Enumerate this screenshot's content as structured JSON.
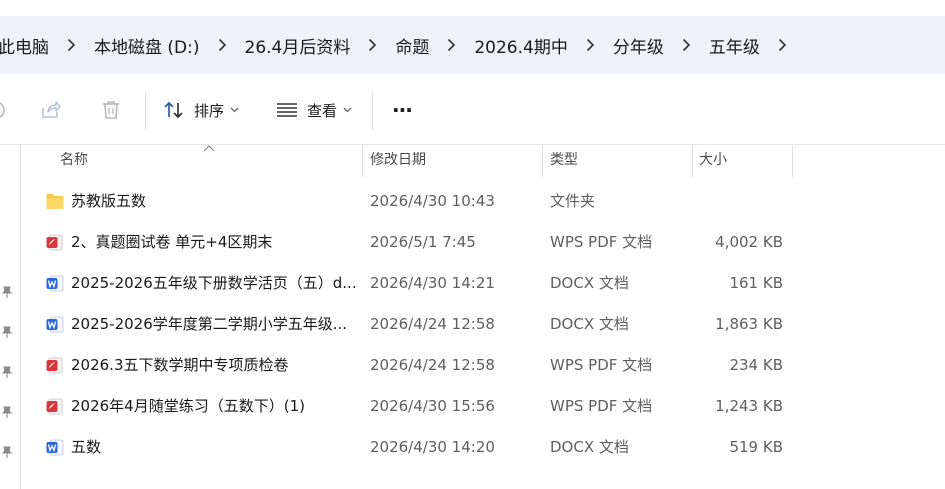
{
  "breadcrumb": {
    "items": [
      "此电脑",
      "本地磁盘 (D:)",
      "26.4月后资料",
      "命题",
      "2026.4期中",
      "分年级",
      "五年级"
    ]
  },
  "toolbar": {
    "sort_label": "排序",
    "view_label": "查看",
    "more_label": "···"
  },
  "columns": {
    "name": "名称",
    "date": "修改日期",
    "type": "类型",
    "size": "大小"
  },
  "files": [
    {
      "name": "苏教版五数",
      "date": "2026/4/30 10:43",
      "type": "文件夹",
      "size": "",
      "icon": "folder-icon"
    },
    {
      "name": "2、真题圈试卷  单元+4区期末",
      "date": "2026/5/1 7:45",
      "type": "WPS PDF 文档",
      "size": "4,002 KB",
      "icon": "pdf-file-icon"
    },
    {
      "name": "2025-2026五年级下册数学活页（五）d...",
      "date": "2026/4/30 14:21",
      "type": "DOCX 文档",
      "size": "161 KB",
      "icon": "word-file-icon"
    },
    {
      "name": "2025-2026学年度第二学期小学五年级...",
      "date": "2026/4/24 12:58",
      "type": "DOCX 文档",
      "size": "1,863 KB",
      "icon": "word-file-icon"
    },
    {
      "name": "2026.3五下数学期中专项质检卷",
      "date": "2026/4/24 12:58",
      "type": "WPS PDF 文档",
      "size": "234 KB",
      "icon": "pdf-file-icon"
    },
    {
      "name": "2026年4月随堂练习（五数下）(1)",
      "date": "2026/4/30 15:56",
      "type": "WPS PDF 文档",
      "size": "1,243 KB",
      "icon": "pdf-file-icon"
    },
    {
      "name": "五数",
      "date": "2026/4/30 14:20",
      "type": "DOCX 文档",
      "size": "519 KB",
      "icon": "word-file-icon"
    }
  ],
  "colors": {
    "breadcrumb_bg": "#eef3f9",
    "folder": "#f8c84a",
    "pdf": "#d9363e",
    "word": "#2b66d9"
  }
}
